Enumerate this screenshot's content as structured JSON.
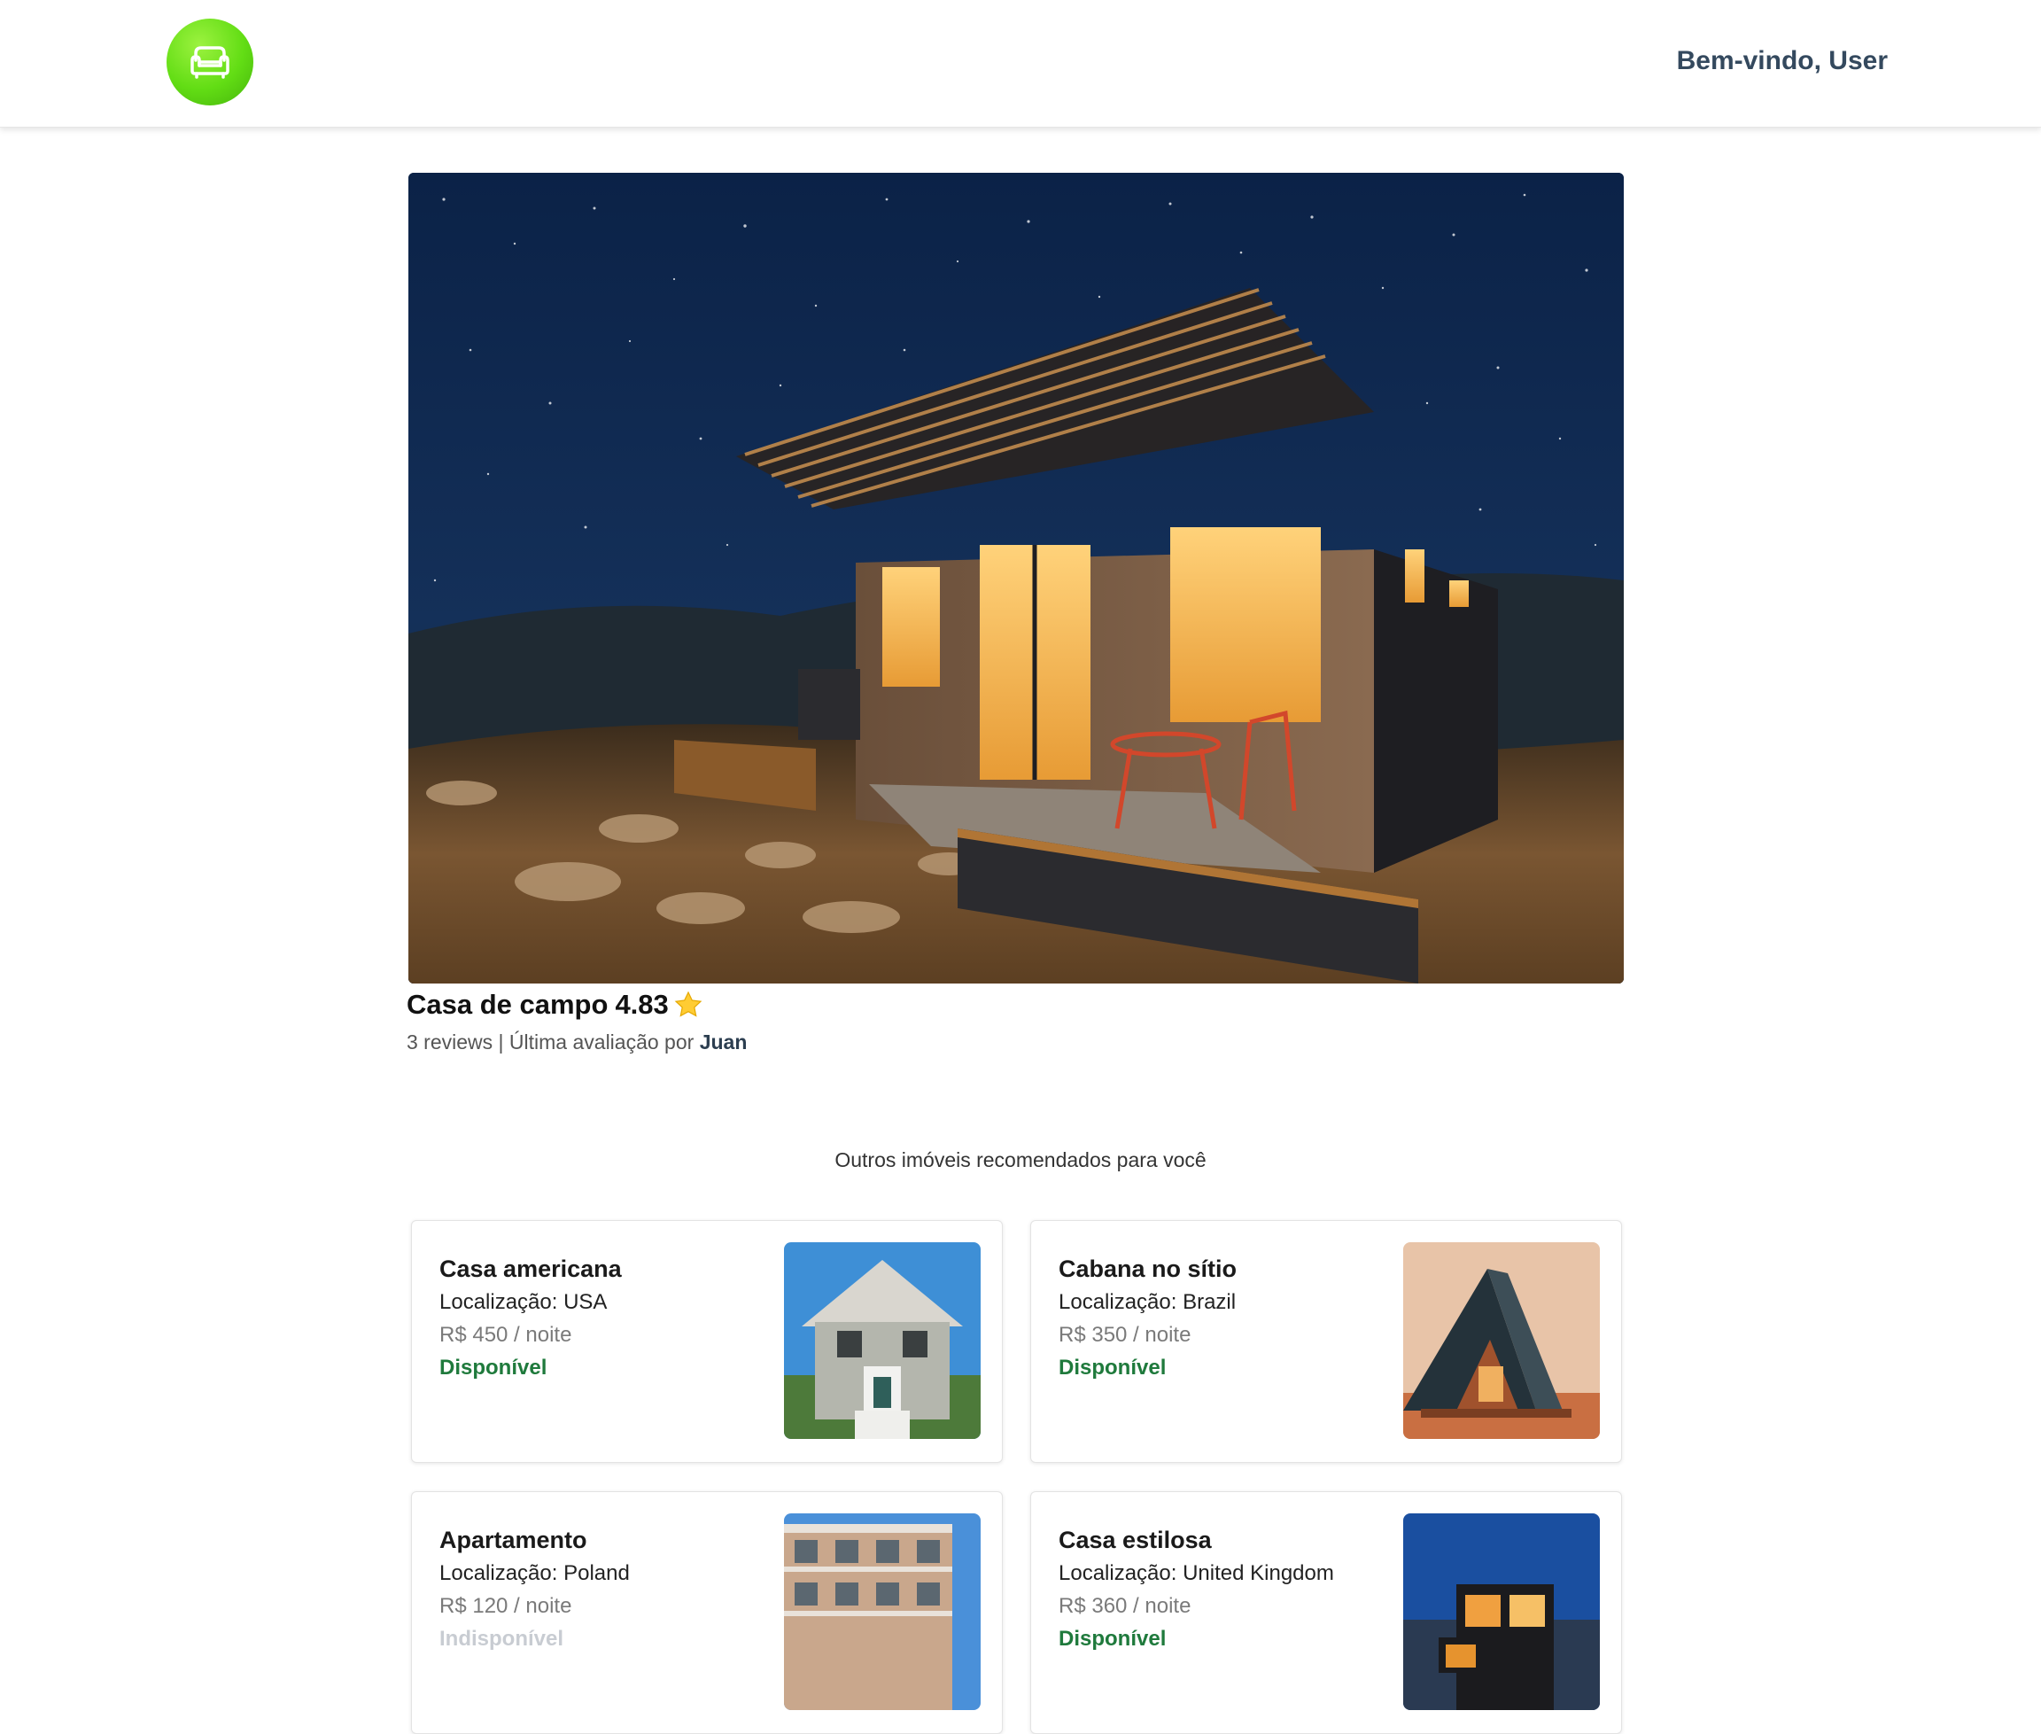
{
  "header": {
    "logo_icon": "sofa-icon",
    "welcome": "Bem-vindo, User",
    "brand_color": "#62dd14"
  },
  "property": {
    "image_icon": "cabin-night-photo",
    "name": "Casa de campo",
    "rating": "4.83",
    "rating_icon": "star-icon",
    "reviews": "3 reviews",
    "separator": "|",
    "last_review_prefix": "Última avaliação por",
    "last_reviewer": "Juan"
  },
  "recommendations": {
    "heading": "Outros imóveis recomendados para você",
    "items": [
      {
        "title": "Casa americana",
        "location": "Localização: USA",
        "price": "R$ 450 / noite",
        "status": "Disponível",
        "available": true,
        "image": "american-house-photo"
      },
      {
        "title": "Cabana no sítio",
        "location": "Localização: Brazil",
        "price": "R$ 350 / noite",
        "status": "Disponível",
        "available": true,
        "image": "a-frame-cabin-photo"
      },
      {
        "title": "Apartamento",
        "location": "Localização: Poland",
        "price": "R$ 120 / noite",
        "status": "Indisponível",
        "available": false,
        "image": "apartment-building-photo"
      },
      {
        "title": "Casa estilosa",
        "location": "Localização: United Kingdom",
        "price": "R$ 360 / noite",
        "status": "Disponível",
        "available": true,
        "image": "modern-house-photo"
      }
    ]
  },
  "colors": {
    "available": "#1f7a3c",
    "unavailable": "#c8ccd2"
  }
}
